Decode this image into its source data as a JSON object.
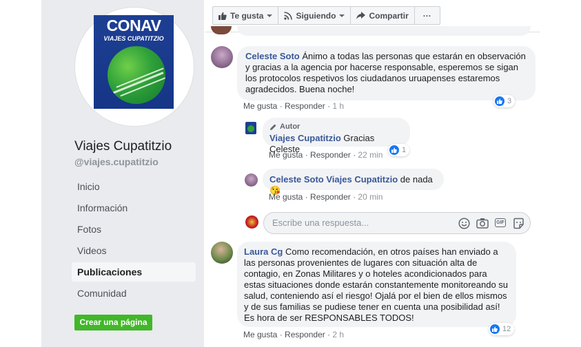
{
  "sidebar": {
    "logo_text": "CONAV",
    "logo_subtitle": "VIAJES CUPATITZIO",
    "page_name": "Viajes Cupatitzio",
    "page_handle": "@viajes.cupatitzio",
    "nav": [
      {
        "label": "Inicio"
      },
      {
        "label": "Información"
      },
      {
        "label": "Fotos"
      },
      {
        "label": "Videos"
      },
      {
        "label": "Publicaciones",
        "active": true
      },
      {
        "label": "Comunidad"
      }
    ],
    "create_page_label": "Crear una página"
  },
  "actions": {
    "like_label": "Te gusta",
    "follow_label": "Siguiendo",
    "share_label": "Compartir",
    "more_label": "···"
  },
  "comments": {
    "c1": {
      "author": "Celeste Soto",
      "text": "Ánimo a todas las personas que estarán en observación y gracias a la agencia por hacerse responsable, esperemos se sigan los protocolos respetivos los ciudadanos uruapenses estaremos agradecidos. Buena noche!",
      "like_label": "Me gusta",
      "reply_label": "Responder",
      "time": "1 h",
      "reactions": "3"
    },
    "r1": {
      "author_tag": "Autor",
      "author": "Viajes Cupatitzio",
      "text": "Gracias Celeste",
      "like_label": "Me gusta",
      "reply_label": "Responder",
      "time": "22 min",
      "reactions": "1"
    },
    "r2": {
      "author": "Celeste Soto",
      "mention": "Viajes Cupatitzio",
      "text": "de nada",
      "emoji": "😘",
      "like_label": "Me gusta",
      "reply_label": "Responder",
      "time": "20 min"
    },
    "reply_box": {
      "placeholder": "Escribe una respuesta..."
    },
    "c2": {
      "author": "Laura Cg",
      "text": "Como recomendación, en otros países han enviado a las personas provenientes de lugares con situación alta de contagio, en Zonas Militares y o hoteles acondicionados para estas situaciones donde estarán constantemente monitoreando su salud, conteniendo así el riesgo! Ojalá por el bien de ellos mismos y de sus familias se pudiese tener en cuenta una posibilidad así! Es hora de ser RESPONSABLES TODOS!",
      "like_label": "Me gusta",
      "reply_label": "Responder",
      "time": "2 h",
      "reactions": "12"
    }
  },
  "colors": {
    "link": "#385898",
    "sidebar_bg": "#e9ebee",
    "bubble_bg": "#f2f3f5",
    "create_btn": "#42b72a",
    "like_blue": "#1877f2"
  }
}
